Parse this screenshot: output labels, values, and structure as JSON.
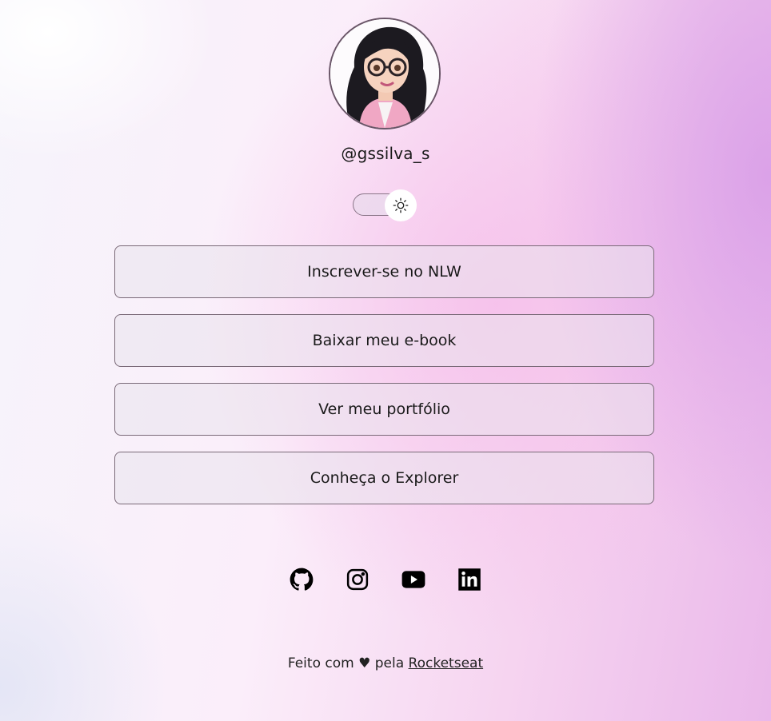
{
  "profile": {
    "handle": "@gssilva_s",
    "avatar_alt": "avatar"
  },
  "theme_toggle": {
    "icon": "sun-icon",
    "state": "light"
  },
  "links": [
    {
      "label": "Inscrever-se no NLW"
    },
    {
      "label": "Baixar meu e-book"
    },
    {
      "label": "Ver meu portfólio"
    },
    {
      "label": "Conheça o Explorer"
    }
  ],
  "social": [
    {
      "icon": "github-icon"
    },
    {
      "icon": "instagram-icon"
    },
    {
      "icon": "youtube-icon"
    },
    {
      "icon": "linkedin-icon"
    }
  ],
  "footer": {
    "text_before": "Feito com",
    "heart": "♥",
    "text_middle": "pela",
    "link_label": "Rocketseat"
  },
  "colors": {
    "accent_purple": "#dba0e8",
    "accent_pink": "#f6beea",
    "text": "#111111"
  }
}
